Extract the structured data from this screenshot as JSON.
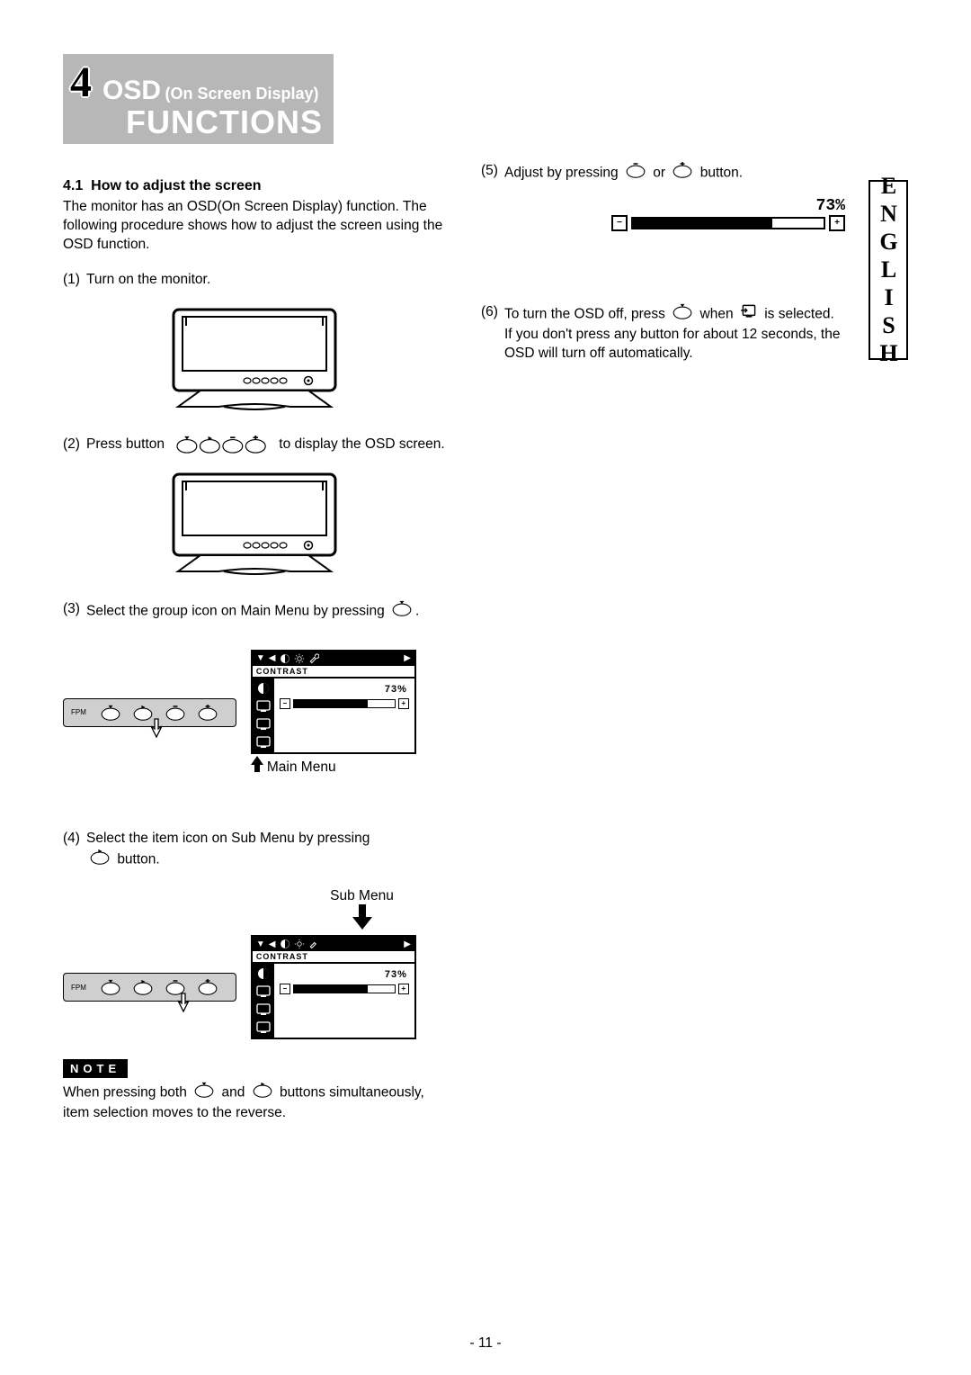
{
  "chapter_number": "4",
  "title_main": "OSD",
  "title_sub": "(On Screen Display)",
  "title_functions": "FUNCTIONS",
  "side_tab": "ENGLISH",
  "section_number": "4.1",
  "section_title": "How to adjust the screen",
  "intro": "The monitor has an OSD(On Screen Display) function. The following procedure shows how to adjust the screen using the OSD function.",
  "steps": {
    "s1": {
      "n": "(1)",
      "t": "Turn on the monitor."
    },
    "s2": {
      "n": "(2)",
      "pre": "Press button",
      "post": "to display the OSD screen."
    },
    "s3": {
      "n": "(3)",
      "pre": "Select the group icon on Main Menu by pressing",
      "post": "."
    },
    "s4": {
      "n": "(4)",
      "pre": "Select the item icon on Sub Menu by pressing",
      "post": "button."
    },
    "s5": {
      "n": "(5)",
      "pre": "Adjust by pressing",
      "mid": "or",
      "post": "button."
    },
    "s6": {
      "n": "(6)",
      "pre": "To turn the OSD off, press",
      "mid": "when",
      "post": "is selected.",
      "extra": "If you don't press any button for about 12 seconds, the OSD will turn off automatically."
    }
  },
  "labels": {
    "main_menu": "Main Menu",
    "sub_menu": "Sub Menu",
    "fpm": "FPM"
  },
  "note_badge": "NOTE",
  "note_body_pre": "When pressing both",
  "note_body_mid": "and",
  "note_body_post": "buttons simultaneously, item selection moves to the reverse.",
  "osd": {
    "header": "CONTRAST",
    "percent": "73%",
    "fill_pct": 73
  },
  "page_number": "- 11 -"
}
